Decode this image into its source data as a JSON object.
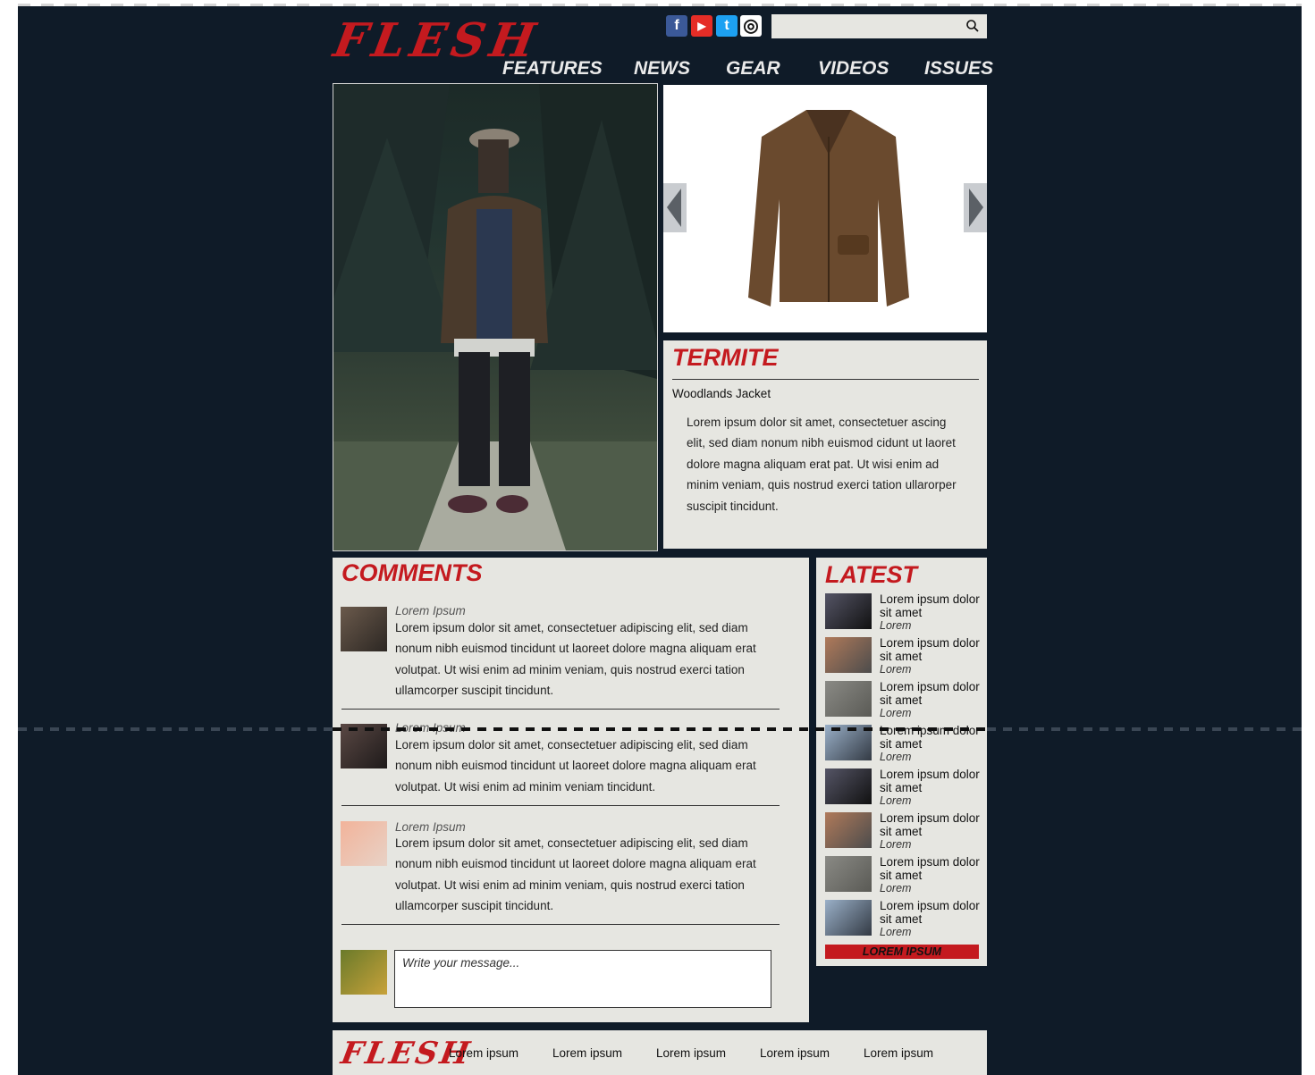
{
  "header": {
    "logo": "FLESH",
    "social": [
      {
        "name": "facebook-icon",
        "glyph": "f",
        "color": "#3b5998"
      },
      {
        "name": "youtube-icon",
        "glyph": "▶",
        "color": "#e52d27"
      },
      {
        "name": "twitter-icon",
        "glyph": "t",
        "color": "#1da1f2"
      },
      {
        "name": "instagram-icon",
        "glyph": "◎",
        "color": "#ffffff"
      }
    ],
    "search": {
      "placeholder": "",
      "icon": "search-icon"
    },
    "nav": [
      "FEATURES",
      "NEWS",
      "GEAR",
      "VIDEOS",
      "ISSUES"
    ]
  },
  "product": {
    "brand": "TERMITE",
    "name": "Woodlands Jacket",
    "description": "Lorem ipsum dolor sit amet, consectetuer ascing elit, sed diam nonum nibh euismod cidunt ut laoret dolore magna aliquam erat pat. Ut wisi enim ad minim veniam, quis nostrud exerci tation ullarorper suscipit tincidunt.",
    "prev_icon": "arrow-left-icon",
    "next_icon": "arrow-right-icon"
  },
  "comments": {
    "title": "COMMENTS",
    "items": [
      {
        "author": "Lorem Ipsum",
        "text": "Lorem ipsum dolor sit amet, consectetuer adipiscing elit, sed diam nonum nibh euismod tincidunt ut laoreet dolore magna aliquam erat volutpat. Ut wisi enim ad minim veniam, quis nostrud exerci tation ullamcorper suscipit tincidunt."
      },
      {
        "author": "Lorem Ipsum",
        "text": "Lorem ipsum dolor sit amet, consectetuer adipiscing elit, sed diam nonum nibh euismod tincidunt ut laoreet dolore magna aliquam erat volutpat. Ut wisi enim ad minim veniam tincidunt."
      },
      {
        "author": "Lorem Ipsum",
        "text": "Lorem ipsum dolor sit amet, consectetuer adipiscing elit, sed diam nonum nibh euismod tincidunt ut laoreet dolore magna aliquam erat volutpat. Ut wisi enim ad minim veniam, quis nostrud exerci tation ullamcorper suscipit tincidunt."
      }
    ],
    "message_placeholder": "Write your message..."
  },
  "latest": {
    "title": "LATEST",
    "items": [
      {
        "title": "Lorem ipsum dolor sit amet",
        "sub": "Lorem"
      },
      {
        "title": "Lorem ipsum dolor sit amet",
        "sub": "Lorem"
      },
      {
        "title": "Lorem ipsum dolor sit amet",
        "sub": "Lorem"
      },
      {
        "title": "Lorem ipsum dolor sit amet",
        "sub": "Lorem"
      },
      {
        "title": "Lorem ipsum dolor sit amet",
        "sub": "Lorem"
      },
      {
        "title": "Lorem ipsum dolor sit amet",
        "sub": "Lorem"
      },
      {
        "title": "Lorem ipsum dolor sit amet",
        "sub": "Lorem"
      },
      {
        "title": "Lorem ipsum dolor sit amet",
        "sub": "Lorem"
      }
    ],
    "more_button": "LOREM IPSUM"
  },
  "footer": {
    "logo": "FLESH",
    "links": [
      "Lorem ipsum",
      "Lorem ipsum",
      "Lorem ipsum",
      "Lorem ipsum",
      "Lorem ipsum"
    ]
  },
  "colors": {
    "accent": "#c41a1f",
    "background": "#0f1b28",
    "panel": "#e6e6e1"
  }
}
